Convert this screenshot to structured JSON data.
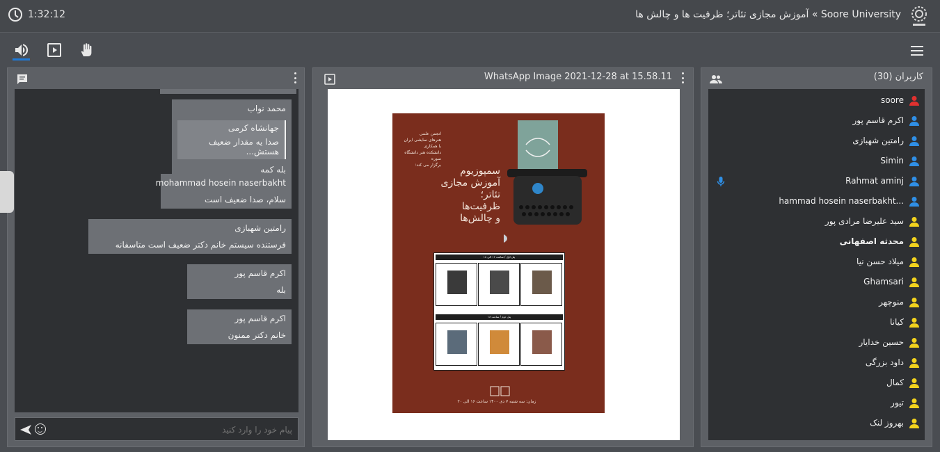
{
  "header": {
    "timer": "1:32:12",
    "title": "Soore University » آموزش مجازی تئاتر؛ ظرفیت ها و چالش ها"
  },
  "toolbar": {
    "audio": "speaker-icon",
    "present": "presentation-icon",
    "raise_hand": "hand-icon",
    "menu": "hamburger-icon"
  },
  "chat": {
    "messages": [
      {
        "name": "محمد نواب",
        "quote_name": "جهانشاه کرمی",
        "quote_text": "صدا یه مقدار ضعیف هستش...",
        "text": "بله کمه"
      },
      {
        "name": "mohammad hosein naserbakht",
        "text": "سلام، صدا ضعیف است"
      },
      {
        "name": "رامتین شهبازی",
        "text": "فرستنده سیستم خانم دکتر ضعیف است متاسفانه"
      },
      {
        "name": "اکرم قاسم پور",
        "text": "بله"
      },
      {
        "name": "اکرم قاسم پور",
        "text": "خانم دکتر ممنون"
      }
    ],
    "input_placeholder": "پیام خود را وارد کنید"
  },
  "presentation": {
    "title": "WhatsApp Image 2021-12-28 at 15.58.11"
  },
  "users": {
    "title": "کاربران (30)",
    "list": [
      {
        "name": "soore",
        "color": "#e0312f",
        "bold": false
      },
      {
        "name": "اکرم قاسم پور",
        "color": "#2f8fe6",
        "bold": false
      },
      {
        "name": "رامتین شهبازی",
        "color": "#2f8fe6",
        "bold": false
      },
      {
        "name": "Simin",
        "color": "#2f8fe6",
        "bold": false
      },
      {
        "name": "Rahmat aminj",
        "color": "#2f8fe6",
        "bold": false
      },
      {
        "name": "hammad hosein naserbakht...",
        "color": "#2f8fe6",
        "bold": false
      },
      {
        "name": "سید علیرضا مرادی پور",
        "color": "#f2d21e",
        "bold": false
      },
      {
        "name": "محدثه اصفهانی",
        "color": "#f2d21e",
        "bold": true
      },
      {
        "name": "میلاد حسن نیا",
        "color": "#f2d21e",
        "bold": false
      },
      {
        "name": "Ghamsari",
        "color": "#f2d21e",
        "bold": false
      },
      {
        "name": "منوچهر",
        "color": "#f2d21e",
        "bold": false
      },
      {
        "name": "کیانا",
        "color": "#f2d21e",
        "bold": false
      },
      {
        "name": "حسین خدایار",
        "color": "#f2d21e",
        "bold": false
      },
      {
        "name": "داود بزرگی",
        "color": "#f2d21e",
        "bold": false
      },
      {
        "name": "کمال",
        "color": "#f2d21e",
        "bold": false
      },
      {
        "name": "تیور",
        "color": "#f2d21e",
        "bold": false
      },
      {
        "name": "بهروز لنک",
        "color": "#f2d21e",
        "bold": false
      }
    ]
  },
  "colors": {
    "accent": "#1f7ad6",
    "moderator": "#e0312f",
    "presenter": "#2f8fe6",
    "viewer": "#f2d21e"
  }
}
